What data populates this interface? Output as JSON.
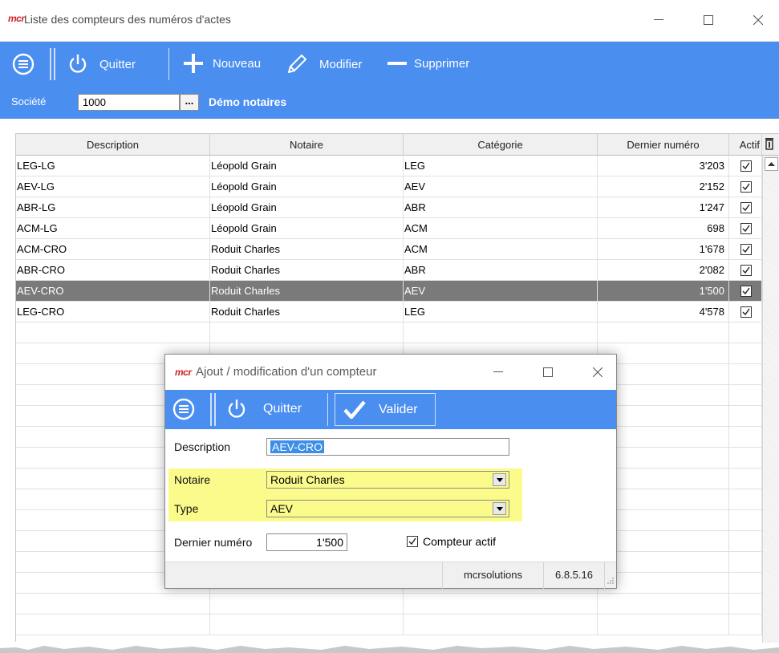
{
  "window": {
    "logo": "mcr",
    "title": "Liste des compteurs des numéros d'actes",
    "minimize": "—",
    "maximize": "☐",
    "close": "✕"
  },
  "toolbar": {
    "quit_label": "Quitter",
    "new_label": "Nouveau",
    "edit_label": "Modifier",
    "delete_label": "Supprimer"
  },
  "company": {
    "label": "Société",
    "code": "1000",
    "lookup": "...",
    "name": "Démo notaires"
  },
  "grid": {
    "headers": [
      "Description",
      "Notaire",
      "Catégorie",
      "Dernier numéro",
      "Actif"
    ],
    "rows": [
      {
        "description": "LEG-LG",
        "notaire": "Léopold Grain",
        "categorie": "LEG",
        "dernier": "3'203",
        "actif": true
      },
      {
        "description": "AEV-LG",
        "notaire": "Léopold Grain",
        "categorie": "AEV",
        "dernier": "2'152",
        "actif": true
      },
      {
        "description": "ABR-LG",
        "notaire": "Léopold Grain",
        "categorie": "ABR",
        "dernier": "1'247",
        "actif": true
      },
      {
        "description": "ACM-LG",
        "notaire": "Léopold Grain",
        "categorie": "ACM",
        "dernier": "698",
        "actif": true
      },
      {
        "description": "ACM-CRO",
        "notaire": "Roduit Charles",
        "categorie": "ACM",
        "dernier": "1'678",
        "actif": true
      },
      {
        "description": "ABR-CRO",
        "notaire": "Roduit Charles",
        "categorie": "ABR",
        "dernier": "2'082",
        "actif": true
      },
      {
        "description": "AEV-CRO",
        "notaire": "Roduit Charles",
        "categorie": "AEV",
        "dernier": "1'500",
        "actif": true,
        "selected": true
      },
      {
        "description": "LEG-CRO",
        "notaire": "Roduit Charles",
        "categorie": "LEG",
        "dernier": "4'578",
        "actif": true
      }
    ]
  },
  "dialog": {
    "logo": "mcr",
    "title": "Ajout / modification d'un compteur",
    "quit_label": "Quitter",
    "validate_label": "Valider",
    "description_label": "Description",
    "description_value": "AEV-CRO",
    "notaire_label": "Notaire",
    "notaire_value": "Roduit Charles",
    "type_label": "Type",
    "type_value": "AEV",
    "dernier_label": "Dernier numéro",
    "dernier_value": "1'500",
    "actif_label": "Compteur actif",
    "actif_checked": true,
    "status_company": "mcrsolutions",
    "status_version": "6.8.5.16"
  },
  "colors": {
    "toolbar_blue": "#4a8ef0",
    "highlight_yellow": "#fbfb8c",
    "selected_row": "#7a7a7a",
    "logo_red": "#d0202a"
  }
}
